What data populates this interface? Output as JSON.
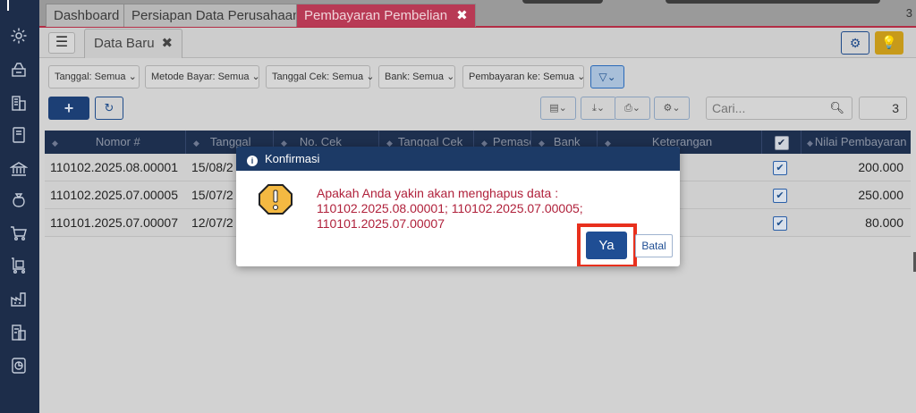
{
  "sidebar": {
    "items": [
      {
        "icon": "gear-icon"
      },
      {
        "icon": "printer-stack-icon"
      },
      {
        "icon": "building-icon"
      },
      {
        "icon": "book-icon"
      },
      {
        "icon": "bank-icon"
      },
      {
        "icon": "money-bag-icon"
      },
      {
        "icon": "cart-icon"
      },
      {
        "icon": "delivery-cart-icon"
      },
      {
        "icon": "factory-icon"
      },
      {
        "icon": "tax-receipt-icon"
      },
      {
        "icon": "report-chart-icon"
      }
    ]
  },
  "tabs": [
    {
      "label": "Dashboard"
    },
    {
      "label": "Persiapan Data Perusahaan"
    },
    {
      "label": "Pembayaran Pembelian",
      "close": "✖"
    }
  ],
  "tab_count": "3",
  "subtab": {
    "label": "Data Baru",
    "close": "✖"
  },
  "filters": [
    {
      "label": "Tanggal: Semua"
    },
    {
      "label": "Metode Bayar: Semua"
    },
    {
      "label": "Tanggal Cek: Semua"
    },
    {
      "label": "Bank: Semua"
    },
    {
      "label": "Pembayaran ke: Semua"
    }
  ],
  "search": {
    "placeholder": "Cari..."
  },
  "page_size": "3",
  "table": {
    "columns": [
      "Nomor #",
      "Tanggal",
      "No. Cek",
      "Tanggal Cek",
      "Pemasok",
      "Bank",
      "Keterangan",
      "",
      "Nilai Pembayaran"
    ],
    "rows": [
      {
        "nomor": "110102.2025.08.00001",
        "tanggal": "15/08/2",
        "nilai": "200.000"
      },
      {
        "nomor": "110102.2025.07.00005",
        "tanggal": "15/07/2",
        "nilai": "250.000"
      },
      {
        "nomor": "110101.2025.07.00007",
        "tanggal": "12/07/2",
        "nilai": "80.000"
      }
    ]
  },
  "dialog": {
    "title": "Konfirmasi",
    "message_line1": "Apakah Anda yakin akan menghapus data :",
    "message_line2": "110102.2025.08.00001; 110102.2025.07.00005;",
    "message_line3": "110101.2025.07.00007",
    "confirm_label": "Ya",
    "cancel_label": "Batal"
  },
  "colors": {
    "sidebar": "#1d2d4a",
    "active_tab": "#b83a55",
    "primary": "#1f4e94",
    "message": "#b0213b",
    "highlight": "#e8301d"
  }
}
